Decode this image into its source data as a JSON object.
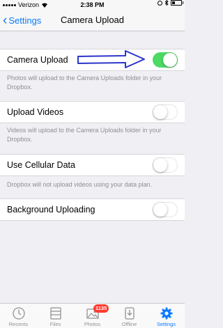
{
  "status_bar": {
    "carrier": "Verizon",
    "time": "2:38 PM",
    "battery_level": 0.3
  },
  "nav": {
    "back_label": "Settings",
    "title": "Camera Upload"
  },
  "settings": [
    {
      "label": "Camera Upload",
      "state": "on",
      "footer": "Photos will upload to the Camera Uploads folder in your Dropbox."
    },
    {
      "label": "Upload Videos",
      "state": "off",
      "footer": "Videos will upload to the Camera Uploads folder in your Dropbox."
    },
    {
      "label": "Use Cellular Data",
      "state": "off",
      "footer": "Dropbox will not upload videos using your data plan."
    },
    {
      "label": "Background Uploading",
      "state": "off",
      "footer": ""
    }
  ],
  "tabs": [
    {
      "label": "Recents",
      "icon": "clock-icon"
    },
    {
      "label": "Files",
      "icon": "files-icon"
    },
    {
      "label": "Photos",
      "icon": "photos-icon",
      "badge": "1135"
    },
    {
      "label": "Offline",
      "icon": "offline-icon"
    },
    {
      "label": "Settings",
      "icon": "gear-icon",
      "active": true
    }
  ],
  "colors": {
    "accent": "#0a7aff",
    "toggle_on": "#4cd964",
    "badge": "#ff3b30",
    "annotation_arrow": "#2b34c9"
  }
}
